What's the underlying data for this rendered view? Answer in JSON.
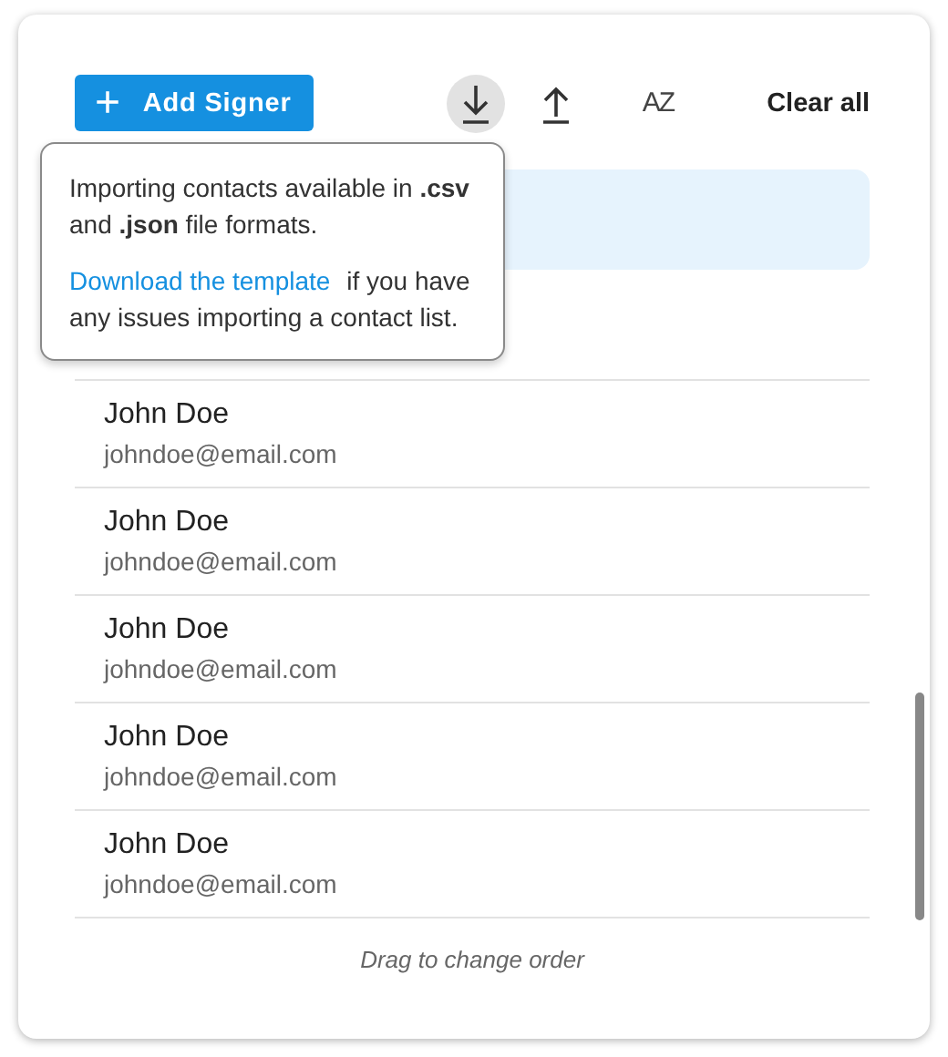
{
  "toolbar": {
    "add_button": {
      "icon": "+",
      "label": "Add Signer"
    },
    "tools": [
      {
        "kind": "download",
        "active": true
      },
      {
        "kind": "upload",
        "active": false
      },
      {
        "kind": "sort",
        "active": false,
        "label": "AZ"
      }
    ],
    "clear_button": "Clear all"
  },
  "covered_rows": [
    {
      "selected": true
    },
    {
      "selected": false
    }
  ],
  "signers": [
    {
      "name": "John Doe",
      "email": "johndoe@email.com",
      "selected": false
    },
    {
      "name": "John Doe",
      "email": "johndoe@email.com",
      "selected": false
    },
    {
      "name": "John Doe",
      "email": "johndoe@email.com",
      "selected": false
    },
    {
      "name": "John Doe",
      "email": "johndoe@email.com",
      "selected": false
    },
    {
      "name": "John Doe",
      "email": "johndoe@email.com",
      "selected": false
    }
  ],
  "footer": "Drag to change order",
  "tooltip": {
    "message": "Importing contacts available in **.csv** and **.json** file formats.",
    "link": "Download the template",
    "after_link": "if you have any issues importing a contact list."
  }
}
